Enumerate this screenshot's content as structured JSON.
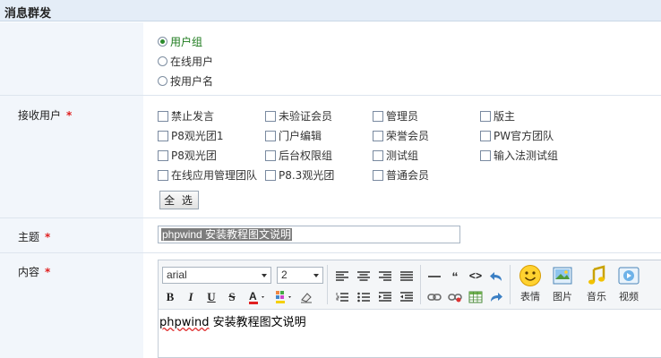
{
  "header": {
    "title": "消息群发"
  },
  "send_mode": {
    "options": [
      {
        "label": "用户组",
        "selected": true
      },
      {
        "label": "在线用户",
        "selected": false
      },
      {
        "label": "按用户名",
        "selected": false
      }
    ]
  },
  "receivers": {
    "label": "接收用户",
    "required_mark": "*",
    "groups": [
      "禁止发言",
      "未验证会员",
      "管理员",
      "版主",
      "P8观光团1",
      "门户编辑",
      "荣誉会员",
      "PW官方团队",
      "P8观光团",
      "后台权限组",
      "测试组",
      "输入法测试组",
      "在线应用管理团队",
      "P8.3观光团",
      "普通会员"
    ],
    "select_all_label": "全 选"
  },
  "subject": {
    "label": "主题",
    "required_mark": "*",
    "value": "phpwind 安装教程图文说明"
  },
  "content": {
    "label": "内容",
    "required_mark": "*",
    "font_family": "arial",
    "font_size": "2",
    "text_word1": "phpwind",
    "text_rest": " 安装教程图文说明",
    "insert_buttons": [
      "表情",
      "图片",
      "音乐",
      "视频"
    ]
  },
  "colors": {
    "header_bg": "#e4edf7",
    "label_bg": "#f2f6fb",
    "required": "#e02020",
    "selected_radio": "#1c7a1c"
  }
}
